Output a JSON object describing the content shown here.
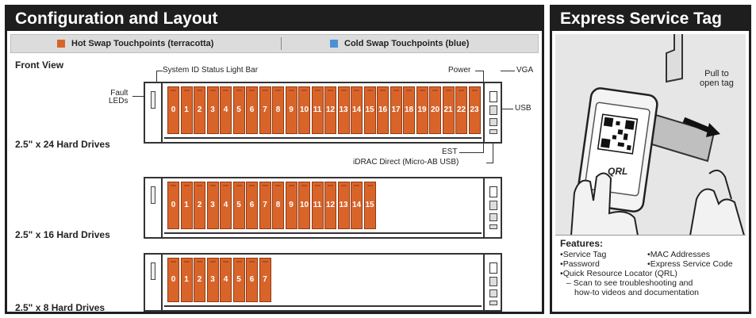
{
  "left_panel": {
    "title": "Configuration and Layout",
    "legend": {
      "hot": "Hot Swap Touchpoints (terracotta)",
      "cold": "Cold Swap Touchpoints (blue)",
      "hot_color": "#d9642a",
      "cold_color": "#4a90d9"
    },
    "front_view_label": "Front View",
    "callouts": {
      "system_id": "System ID Status Light Bar",
      "power": "Power",
      "vga": "VGA",
      "usb": "USB",
      "fault_leds_line1": "Fault",
      "fault_leds_line2": "LEDs",
      "est": "EST",
      "idrac": "iDRAC Direct (Micro-AB USB)"
    },
    "configs": [
      {
        "label": "2.5\" x 24 Hard Drives",
        "bays": [
          "0",
          "1",
          "2",
          "3",
          "4",
          "5",
          "6",
          "7",
          "8",
          "9",
          "10",
          "11",
          "12",
          "13",
          "14",
          "15",
          "16",
          "17",
          "18",
          "19",
          "20",
          "21",
          "22",
          "23"
        ]
      },
      {
        "label": "2.5\" x 16 Hard Drives",
        "bays": [
          "0",
          "1",
          "2",
          "3",
          "4",
          "5",
          "6",
          "7",
          "8",
          "9",
          "10",
          "11",
          "12",
          "13",
          "14",
          "15"
        ]
      },
      {
        "label": "2.5\" x 8 Hard Drives",
        "bays": [
          "0",
          "1",
          "2",
          "3",
          "4",
          "5",
          "6",
          "7"
        ]
      }
    ]
  },
  "right_panel": {
    "title": "Express Service Tag",
    "pull_label_line1": "Pull to",
    "pull_label_line2": "open tag",
    "qrl_label": "QRL",
    "features_title": "Features:",
    "features": {
      "service_tag": "Service Tag",
      "mac": "MAC Addresses",
      "password": "Password",
      "express_code": "Express Service Code",
      "qrl": "Quick Resource Locator (QRL)",
      "qrl_note_line1": "– Scan to see troubleshooting and",
      "qrl_note_line2": "how-to videos and documentation"
    }
  }
}
